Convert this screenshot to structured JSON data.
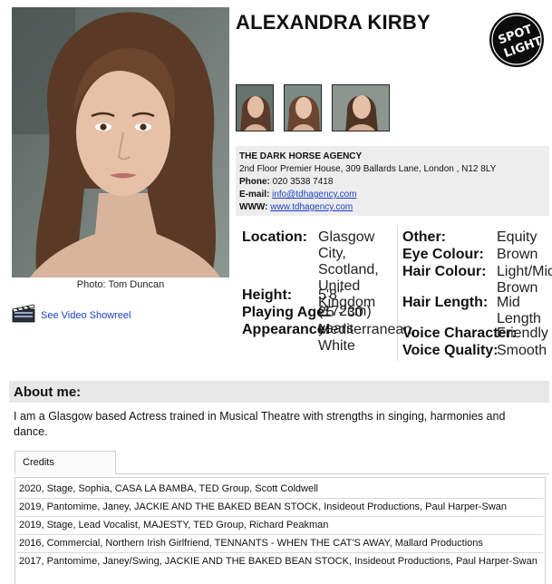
{
  "profile": {
    "name": "ALEXANDRA KIRBY",
    "photo_credit": "Photo: Tom Duncan",
    "showreel_label": "See Video Showreel",
    "logo_letters": "SPOTLIGHT"
  },
  "agency": {
    "name": "THE DARK HORSE AGENCY",
    "address": "2nd Floor Premier House, 309 Ballards Lane, London , N12 8LY",
    "phone_label": "Phone:",
    "phone": "020 3538 7418",
    "email_label": "E-mail:",
    "email": "info@tdhagency.com",
    "www_label": "WWW:",
    "www": "www.tdhagency.com"
  },
  "attributes": {
    "location_label": "Location:",
    "location": "Glasgow City, Scotland, United Kingdom",
    "height_label": "Height:",
    "height": "5'8\" (172cm)",
    "playing_age_label": "Playing Age:",
    "playing_age": "25 - 30 years",
    "appearance_label": "Appearance:",
    "appearance": "Mediterranean, White",
    "other_label": "Other:",
    "other": "Equity",
    "eye_label": "Eye Colour:",
    "eye": "Brown",
    "hair_colour_label": "Hair Colour:",
    "hair_colour": "Light/Mid Brown",
    "hair_length_label": "Hair Length:",
    "hair_length": "Mid Length",
    "voice_character_label": "Voice Character:",
    "voice_character": "Friendly",
    "voice_quality_label": "Voice Quality:",
    "voice_quality": "Smooth"
  },
  "about": {
    "heading": "About me:",
    "text": "I am a Glasgow based Actress trained in Musical Theatre with strengths in singing, harmonies and dance."
  },
  "credits": {
    "tab_label": "Credits",
    "rows": [
      "2020, Stage, Sophia, CASA LA BAMBA, TED Group, Scott Coldwell",
      "2019, Pantomime, Janey, JACKIE AND THE BAKED BEAN STOCK, Insideout Productions, Paul Harper-Swan",
      "2019, Stage, Lead Vocalist, MAJESTY, TED Group, Richard Peakman",
      "2016, Commercial, Northern Irish Girlfriend, TENNANTS - WHEN THE CAT'S AWAY, Mallard Productions",
      "2017, Pantomime, Janey/Swing, JACKIE AND THE BAKED BEAN STOCK, Insideout Productions, Paul Harper-Swan"
    ]
  },
  "colors": {
    "link": "#1a3fbf",
    "panel": "#ededed",
    "header_bar": "#e7e7e7"
  },
  "icons": {
    "showreel": "clapperboard-icon",
    "logo": "spotlight-logo"
  }
}
